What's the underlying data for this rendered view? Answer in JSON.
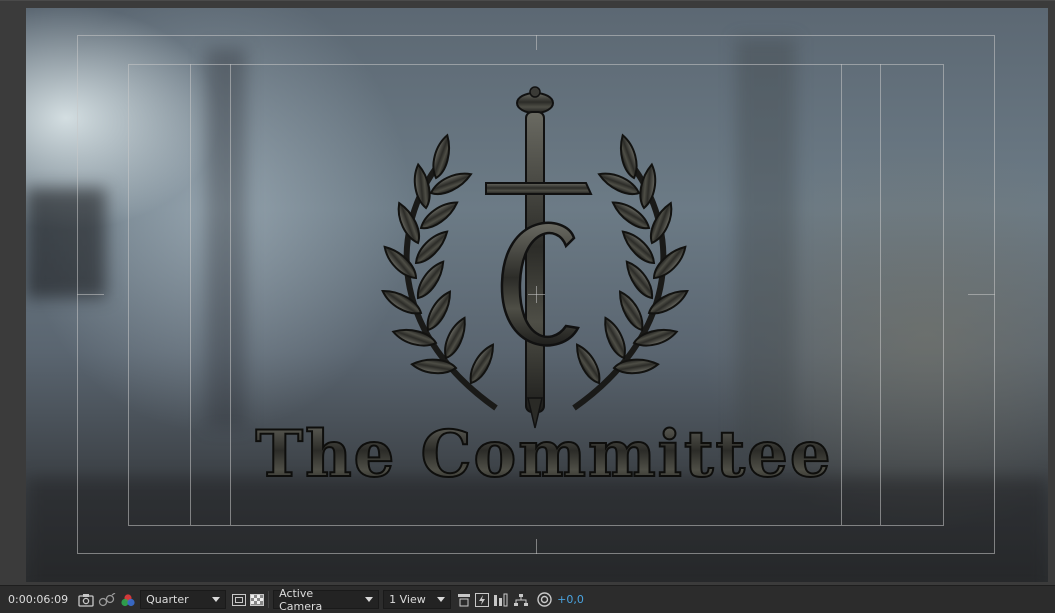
{
  "viewer": {
    "logo_text": "The Committee",
    "logo_monogram": "C"
  },
  "statusbar": {
    "timecode": "0:00:06:09",
    "resolution": "Quarter",
    "camera": "Active Camera",
    "views": "1 View",
    "exposure": "+0,0"
  },
  "icons": {
    "snapshot": "camera-icon",
    "show_snapshot": "show-snapshot-icon",
    "channels": "color-channels-icon",
    "roi": "region-of-interest-icon",
    "transparency": "transparency-grid-icon",
    "toggle_pixel_aspect": "pixel-aspect-icon",
    "fast_previews": "fast-previews-icon",
    "timeline": "timeline-icon",
    "flowchart": "flowchart-icon",
    "reset_exposure": "reset-exposure-icon"
  },
  "colors": {
    "accent": "#4aa3df",
    "panel": "#2c2c2c"
  }
}
